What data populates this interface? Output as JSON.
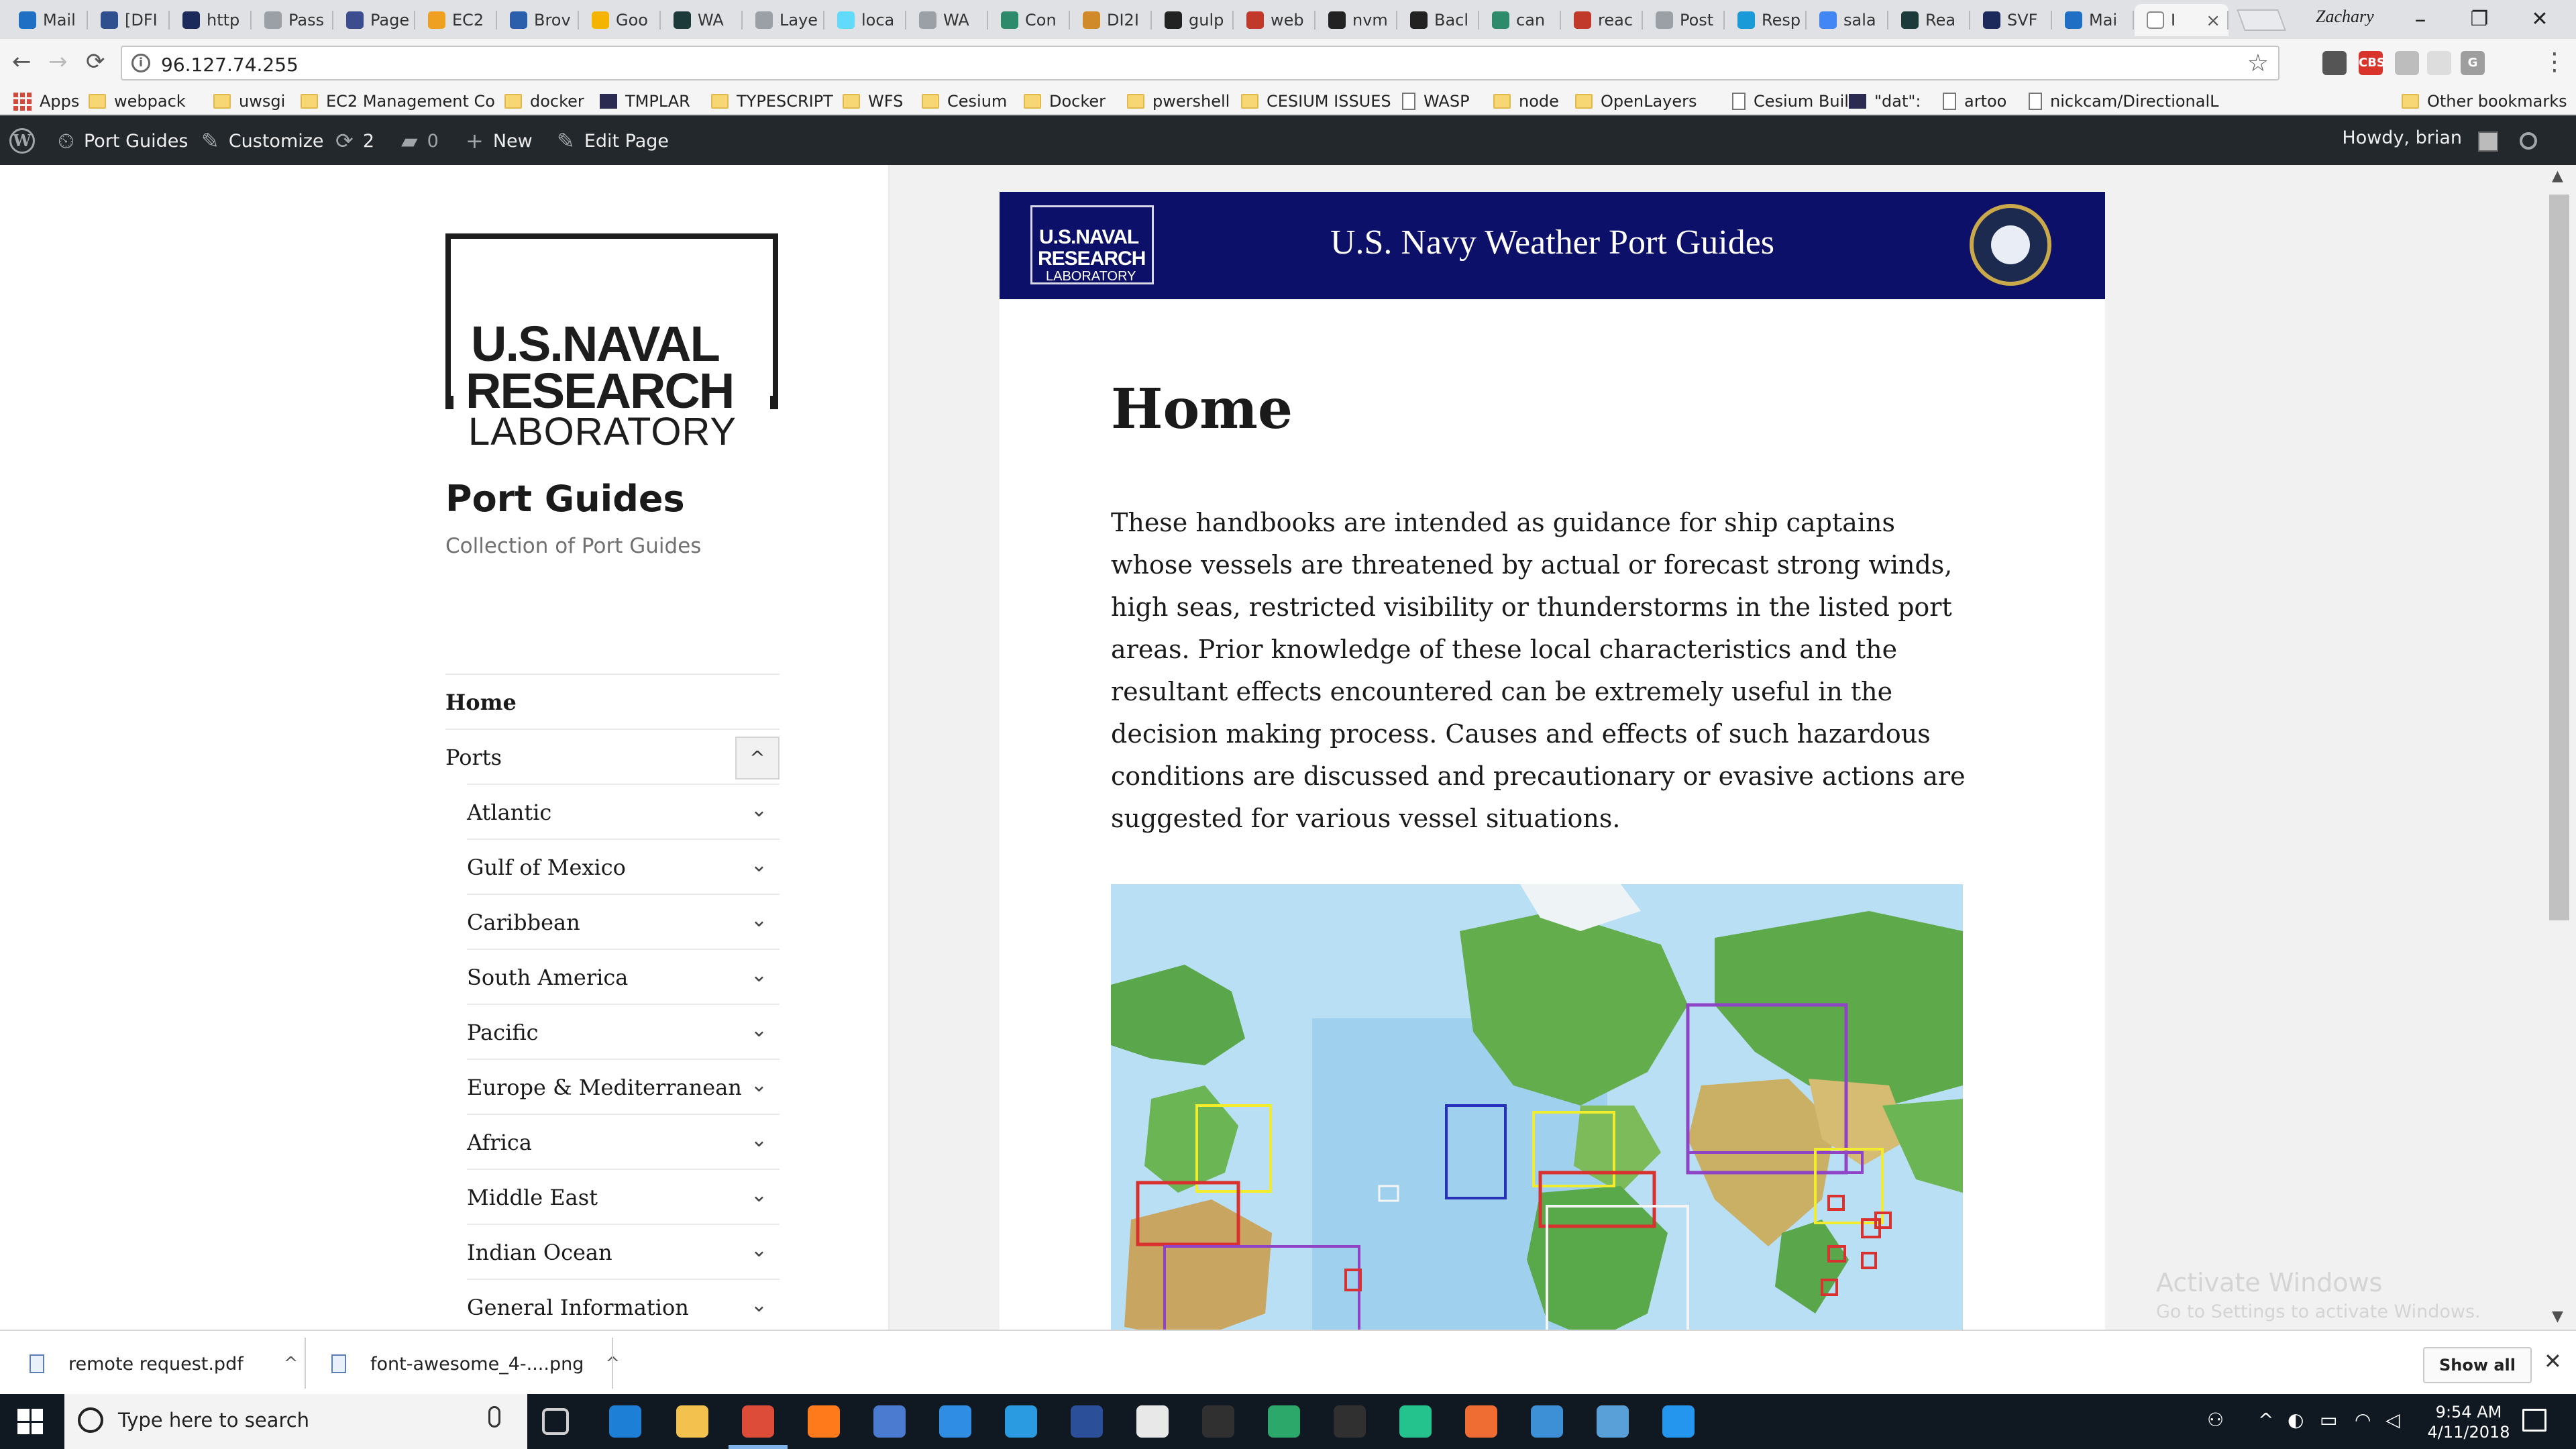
{
  "browser": {
    "tabs": [
      {
        "label": "Mail",
        "color": "#1f6fc4"
      },
      {
        "label": "[DFI",
        "color": "#2f4f8f"
      },
      {
        "label": "http",
        "color": "#1b2a5a"
      },
      {
        "label": "Pass",
        "color": "#9aa0a6"
      },
      {
        "label": "Page",
        "color": "#3b4d8f"
      },
      {
        "label": "EC2",
        "color": "#f0a020"
      },
      {
        "label": "Brov",
        "color": "#2c5fab"
      },
      {
        "label": "Goo",
        "color": "#f4b400"
      },
      {
        "label": "WA",
        "color": "#1c3a3a"
      },
      {
        "label": "Laye",
        "color": "#9aa0a6"
      },
      {
        "label": "loca",
        "color": "#61dafb"
      },
      {
        "label": "WA",
        "color": "#9aa0a6"
      },
      {
        "label": "Con",
        "color": "#2d8a6a"
      },
      {
        "label": "DI2I",
        "color": "#d08a2a"
      },
      {
        "label": "gulp",
        "color": "#222222"
      },
      {
        "label": "web",
        "color": "#c0392b"
      },
      {
        "label": "nvm",
        "color": "#222222"
      },
      {
        "label": "Bacl",
        "color": "#222222"
      },
      {
        "label": "can",
        "color": "#2d8a6a"
      },
      {
        "label": "reac",
        "color": "#c0392b"
      },
      {
        "label": "Post",
        "color": "#9aa0a6"
      },
      {
        "label": "Resp",
        "color": "#1a9ad6"
      },
      {
        "label": "sala",
        "color": "#4285f4"
      },
      {
        "label": "Rea",
        "color": "#1c3a3a"
      },
      {
        "label": "SVF",
        "color": "#1b2a5a"
      },
      {
        "label": "Mai",
        "color": "#1f6fc4"
      }
    ],
    "active_tab": {
      "label": "I",
      "close": "×"
    },
    "profile_name": "Zachary",
    "window_buttons": {
      "minimize": "–",
      "restore": "❐",
      "close": "✕"
    },
    "url": "96.127.74.255",
    "info_icon": "i",
    "star_icon": "☆",
    "nav": {
      "back": "←",
      "forward": "→",
      "reload": "⟳"
    },
    "extensions": [
      {
        "label": "",
        "color": "#555555"
      },
      {
        "label": "CBS",
        "color": "#d9342b"
      },
      {
        "label": "",
        "color": "#bdbdbd"
      },
      {
        "label": "",
        "color": "#dddddd"
      },
      {
        "label": "G",
        "color": "#9e9e9e"
      }
    ],
    "menu_icon": "⋮"
  },
  "bookmarks": {
    "apps_label": "Apps",
    "items": [
      {
        "label": "webpack",
        "kind": "folder"
      },
      {
        "label": "uwsgi",
        "kind": "folder"
      },
      {
        "label": "EC2 Management Co",
        "kind": "folder"
      },
      {
        "label": "docker",
        "kind": "folder"
      },
      {
        "label": "TMPLAR",
        "kind": "square"
      },
      {
        "label": "TYPESCRIPT",
        "kind": "folder"
      },
      {
        "label": "WFS",
        "kind": "folder"
      },
      {
        "label": "Cesium",
        "kind": "folder"
      },
      {
        "label": "Docker",
        "kind": "folder"
      },
      {
        "label": "pwershell",
        "kind": "folder"
      },
      {
        "label": "CESIUM ISSUES",
        "kind": "folder"
      },
      {
        "label": "WASP",
        "kind": "page"
      },
      {
        "label": "node",
        "kind": "folder"
      },
      {
        "label": "OpenLayers",
        "kind": "folder"
      },
      {
        "label": "Cesium Build",
        "kind": "page"
      },
      {
        "label": "\"dat\":",
        "kind": "square"
      },
      {
        "label": "artoo",
        "kind": "page"
      },
      {
        "label": "nickcam/DirectionalL",
        "kind": "page"
      }
    ],
    "other": "Other bookmarks"
  },
  "wp_admin_bar": {
    "wp_logo": "W",
    "site_name": "Port Guides",
    "customize": "Customize",
    "updates_count": "2",
    "comments_count": "0",
    "new_label": "New",
    "edit_label": "Edit Page",
    "howdy": "Howdy, brian"
  },
  "sidebar": {
    "logo": {
      "line1": "U.S.NAVAL",
      "line2": "RESEARCH",
      "line3": "LABORATORY"
    },
    "site_title": "Port Guides",
    "site_description": "Collection of Port Guides",
    "menu": {
      "home": "Home",
      "ports": "Ports",
      "ports_toggle": "^",
      "submenu": [
        "Atlantic",
        "Gulf of Mexico",
        "Caribbean",
        "South America",
        "Pacific",
        "Europe & Mediterranean",
        "Africa",
        "Middle East",
        "Indian Ocean",
        "General Information"
      ],
      "chevron": "⌄"
    }
  },
  "article": {
    "banner": {
      "nrl_line1": "U.S.NAVAL",
      "nrl_line2": "RESEARCH",
      "nrl_line3": "LABORATORY",
      "title": "U.S. Navy Weather Port Guides"
    },
    "title": "Home",
    "intro": "These handbooks are intended as guidance for ship captains whose vessels are threatened by actual or forecast strong winds, high seas, restricted visibility or thunderstorms in the listed port areas. Prior knowledge of these local characteristics and the resultant effects encountered can be extremely useful in the decision making process. Causes and effects of such hazardous conditions are discussed and precautionary or evasive actions are suggested for various vessel situations."
  },
  "watermark": {
    "line1": "Activate Windows",
    "line2": "Go to Settings to activate Windows."
  },
  "downloads": {
    "items": [
      "remote request.pdf",
      "font-awesome_4-....png"
    ],
    "caret": "^",
    "show_all": "Show all",
    "close": "✕"
  },
  "taskbar": {
    "search_placeholder": "Type here to search",
    "apps": [
      {
        "name": "task-view",
        "color": "#d0d0d0"
      },
      {
        "name": "edge",
        "color": "#1e7fd6"
      },
      {
        "name": "file-explorer",
        "color": "#f2c14e"
      },
      {
        "name": "chrome",
        "color": "#dd4b39"
      },
      {
        "name": "firefox",
        "color": "#ff7a1a"
      },
      {
        "name": "network-app",
        "color": "#4a7bd0"
      },
      {
        "name": "vscode",
        "color": "#2f8de4"
      },
      {
        "name": "internet-explorer",
        "color": "#2a9be0"
      },
      {
        "name": "powershell",
        "color": "#2b4f99"
      },
      {
        "name": "mail",
        "color": "#e8e8e8"
      },
      {
        "name": "terminal",
        "color": "#303030"
      },
      {
        "name": "git-kraken",
        "color": "#2da86b"
      },
      {
        "name": "terminal-2",
        "color": "#303030"
      },
      {
        "name": "telegram",
        "color": "#24c28c"
      },
      {
        "name": "postman",
        "color": "#ef6c33"
      },
      {
        "name": "search-app",
        "color": "#3d8fd6"
      },
      {
        "name": "remote-desktop",
        "color": "#5aa0d8"
      },
      {
        "name": "docker",
        "color": "#2496ed"
      }
    ],
    "time": "9:54 AM",
    "date": "4/11/2018"
  }
}
